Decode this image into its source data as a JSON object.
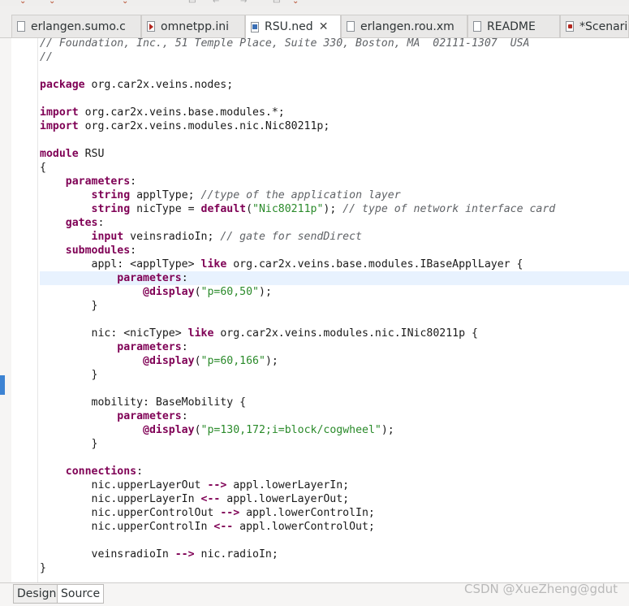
{
  "editor_tabs": [
    {
      "label": "erlangen.sumo.c",
      "icon": "xml-file-icon",
      "active": false
    },
    {
      "label": "omnetpp.ini",
      "icon": "ini-file-icon",
      "active": false
    },
    {
      "label": "RSU.ned",
      "icon": "ned-file-icon",
      "active": true,
      "close": "✕"
    },
    {
      "label": "erlangen.rou.xm",
      "icon": "xml-file-icon",
      "active": false
    },
    {
      "label": "README",
      "icon": "text-file-icon",
      "active": false
    },
    {
      "label": "*Scenario",
      "icon": "ned-file-icon",
      "active": false
    }
  ],
  "code_lines": [
    "// Foundation, Inc., 51 Temple Place, Suite 330, Boston, MA  02111-1307  USA",
    "//",
    "",
    "package org.car2x.veins.nodes;",
    "",
    "import org.car2x.veins.base.modules.*;",
    "import org.car2x.veins.modules.nic.Nic80211p;",
    "",
    "module RSU",
    "{",
    "    parameters:",
    "        string applType; //type of the application layer",
    "        string nicType = default(\"Nic80211p\"); // type of network interface card",
    "    gates:",
    "        input veinsradioIn; // gate for sendDirect",
    "    submodules:",
    "        appl: <applType> like org.car2x.veins.base.modules.IBaseApplLayer {",
    "            parameters:",
    "                @display(\"p=60,50\");",
    "        }",
    "",
    "        nic: <nicType> like org.car2x.veins.modules.nic.INic80211p {",
    "            parameters:",
    "                @display(\"p=60,166\");",
    "        }",
    "",
    "        mobility: BaseMobility {",
    "            parameters:",
    "                @display(\"p=130,172;i=block/cogwheel\");",
    "        }",
    "",
    "    connections:",
    "        nic.upperLayerOut --> appl.lowerLayerIn;",
    "        nic.upperLayerIn <-- appl.lowerLayerOut;",
    "        nic.upperControlOut --> appl.lowerControlIn;",
    "        nic.upperControlIn <-- appl.lowerControlOut;",
    "",
    "        veinsradioIn --> nic.radioIn;",
    "}"
  ],
  "highlighted_line": 17,
  "bottom_tabs": [
    {
      "label": "Design",
      "active": false
    },
    {
      "label": "Source",
      "active": true
    }
  ],
  "watermark": "CSDN @XueZheng@gdut",
  "colors": {
    "keyword": "#7f0055",
    "comment": "#5f6266",
    "string": "#2a8a2a",
    "current_line": "#e8f2fe"
  }
}
